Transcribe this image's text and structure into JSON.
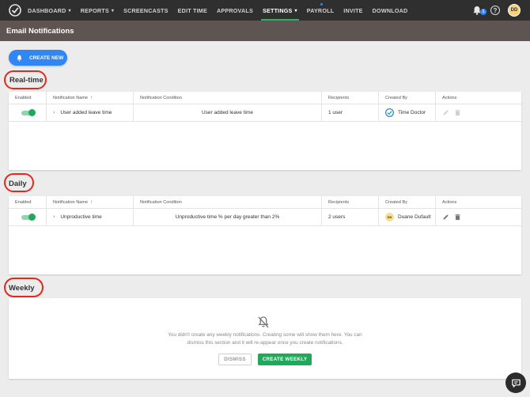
{
  "nav": {
    "items": [
      {
        "label": "DASHBOARD",
        "dropdown": true
      },
      {
        "label": "REPORTS",
        "dropdown": true
      },
      {
        "label": "SCREENCASTS"
      },
      {
        "label": "EDIT TIME"
      },
      {
        "label": "APPROVALS"
      },
      {
        "label": "SETTINGS",
        "dropdown": true,
        "active": true
      },
      {
        "label": "PAYROLL"
      },
      {
        "label": "INVITE"
      },
      {
        "label": "DOWNLOAD"
      }
    ],
    "notification_count": "1",
    "user_initials": "DD"
  },
  "page": {
    "title": "Email Notifications",
    "create_new_label": "CREATE NEW"
  },
  "columns": {
    "enabled": "Enabled",
    "name": "Notification Name",
    "condition": "Notification Condition",
    "recipients": "Recipients",
    "created_by": "Created By",
    "actions": "Actions"
  },
  "realtime": {
    "title": "Real-time",
    "row": {
      "name": "User added leave time",
      "condition": "User added leave time",
      "recipients": "1 user",
      "created_by": "Time Doctor",
      "enabled": true
    }
  },
  "daily": {
    "title": "Daily",
    "row": {
      "name": "Unproductive time",
      "condition": "Unproductive time % per day greater than 2%",
      "recipients": "2 users",
      "created_by": "Duane Dufault",
      "creator_initials": "DD",
      "enabled": true
    }
  },
  "weekly": {
    "title": "Weekly",
    "empty_text": "You didn't create any weekly notifications. Creating some will show them here. You can dismiss this section and it will re-appear once you create notifications.",
    "dismiss_label": "DISMISS",
    "create_label": "CREATE WEEKLY"
  },
  "colors": {
    "accent_green": "#22a85b",
    "primary_blue": "#2f86f4",
    "highlight_ring": "#e02a1e",
    "nav_bg": "#2f2f2f",
    "header_bg": "#5e5552"
  }
}
